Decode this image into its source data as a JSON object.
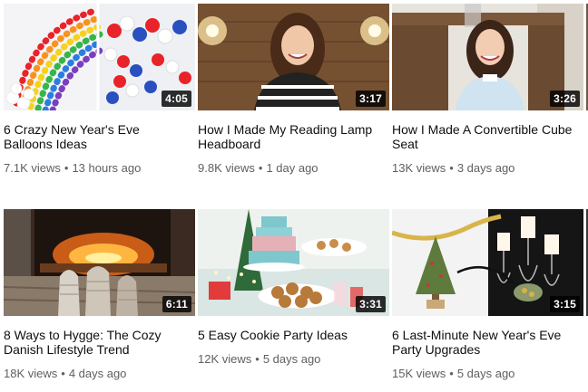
{
  "videos": [
    {
      "title": "6 Crazy New Year's Eve Balloons Ideas",
      "duration": "4:05",
      "views": "7.1K views",
      "age": "13 hours ago",
      "thumbnail": "balloon-rainbow"
    },
    {
      "title": "How I Made My Reading Lamp Headboard",
      "duration": "3:17",
      "views": "9.8K views",
      "age": "1 day ago",
      "thumbnail": "woman-wooden-headboard"
    },
    {
      "title": "How I Made A Convertible Cube Seat",
      "duration": "3:26",
      "views": "13K views",
      "age": "3 days ago",
      "thumbnail": "woman-wooden-cube"
    },
    {
      "title": "8 Ways to Hygge: The Cozy Danish Lifestyle Trend",
      "duration": "6:11",
      "views": "18K views",
      "age": "4 days ago",
      "thumbnail": "socks-by-fireplace"
    },
    {
      "title": "5 Easy Cookie Party Ideas",
      "duration": "3:31",
      "views": "12K views",
      "age": "5 days ago",
      "thumbnail": "cookie-party-table"
    },
    {
      "title": "6 Last-Minute New Year's Eve Party Upgrades",
      "duration": "3:15",
      "views": "15K views",
      "age": "5 days ago",
      "thumbnail": "tree-and-candles"
    }
  ],
  "separator": "•"
}
